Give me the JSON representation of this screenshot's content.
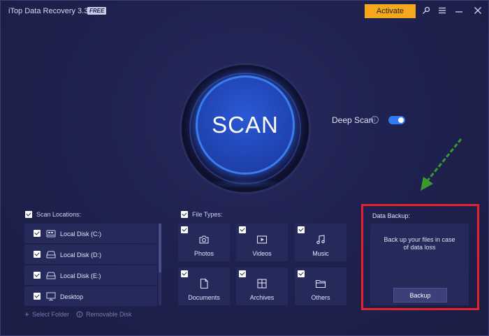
{
  "window": {
    "title": "iTop Data Recovery 3.3",
    "badge": "FREE",
    "activate_label": "Activate",
    "icons": [
      "key-icon",
      "menu-icon",
      "minimize-icon",
      "close-icon"
    ]
  },
  "scan": {
    "label": "SCAN",
    "deep_scan_label": "Deep Scan",
    "deep_scan_enabled": true,
    "info_glyph": "i"
  },
  "locations": {
    "header": "Scan Locations:",
    "checked": true,
    "items": [
      {
        "label": "Local Disk (C:)",
        "icon": "drive-system-icon",
        "checked": true
      },
      {
        "label": "Local Disk (D:)",
        "icon": "drive-icon",
        "checked": true
      },
      {
        "label": "Local Disk (E:)",
        "icon": "drive-icon",
        "checked": true
      },
      {
        "label": "Desktop",
        "icon": "monitor-icon",
        "checked": true
      }
    ],
    "select_folder": "Select Folder",
    "removable_disk": "Removable Disk"
  },
  "file_types": {
    "header": "File Types:",
    "checked": true,
    "items": [
      {
        "label": "Photos",
        "icon": "camera-icon",
        "checked": true
      },
      {
        "label": "Videos",
        "icon": "video-icon",
        "checked": true
      },
      {
        "label": "Music",
        "icon": "music-icon",
        "checked": true
      },
      {
        "label": "Documents",
        "icon": "document-icon",
        "checked": true
      },
      {
        "label": "Archives",
        "icon": "archive-icon",
        "checked": true
      },
      {
        "label": "Others",
        "icon": "folder-icon",
        "checked": true
      }
    ]
  },
  "backup": {
    "header": "Data Backup:",
    "description": "Back up your files in case of data loss",
    "button_label": "Backup"
  },
  "colors": {
    "background": "#1e2147",
    "card": "#262a5a",
    "accent_blue": "#2f7cf6",
    "activate_orange": "#f5a81c",
    "highlight_red": "#e4232c",
    "annotation_green": "#3a9a2a"
  }
}
